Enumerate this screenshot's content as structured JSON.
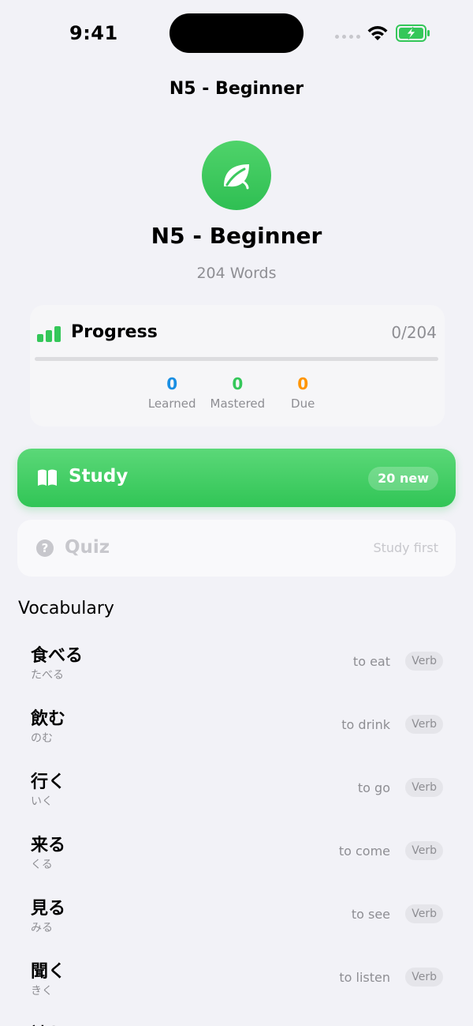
{
  "status_bar": {
    "time": "9:41"
  },
  "nav": {
    "title": "N5 - Beginner"
  },
  "hero": {
    "icon": "leaf-icon",
    "title": "N5 - Beginner",
    "subtitle": "204 Words"
  },
  "progress": {
    "icon": "bar-chart-icon",
    "label": "Progress",
    "count": "0/204",
    "fraction": 0,
    "stats": [
      {
        "value": "0",
        "label": "Learned",
        "color": "#1a8fe3"
      },
      {
        "value": "0",
        "label": "Mastered",
        "color": "#34c759"
      },
      {
        "value": "0",
        "label": "Due",
        "color": "#ff9500"
      }
    ]
  },
  "study": {
    "icon": "book-icon",
    "label": "Study",
    "badge": "20 new"
  },
  "quiz": {
    "icon": "question-circle-icon",
    "label": "Quiz",
    "hint": "Study first"
  },
  "vocabulary": {
    "heading": "Vocabulary",
    "items": [
      {
        "word": "食べる",
        "reading": "たべる",
        "meaning": "to eat",
        "pos": "Verb"
      },
      {
        "word": "飲む",
        "reading": "のむ",
        "meaning": "to drink",
        "pos": "Verb"
      },
      {
        "word": "行く",
        "reading": "いく",
        "meaning": "to go",
        "pos": "Verb"
      },
      {
        "word": "来る",
        "reading": "くる",
        "meaning": "to come",
        "pos": "Verb"
      },
      {
        "word": "見る",
        "reading": "みる",
        "meaning": "to see",
        "pos": "Verb"
      },
      {
        "word": "聞く",
        "reading": "きく",
        "meaning": "to listen",
        "pos": "Verb"
      },
      {
        "word": "読む",
        "reading": "",
        "meaning": "",
        "pos": ""
      }
    ]
  },
  "colors": {
    "accent": "#34c759",
    "background": "#f2f2f7"
  }
}
